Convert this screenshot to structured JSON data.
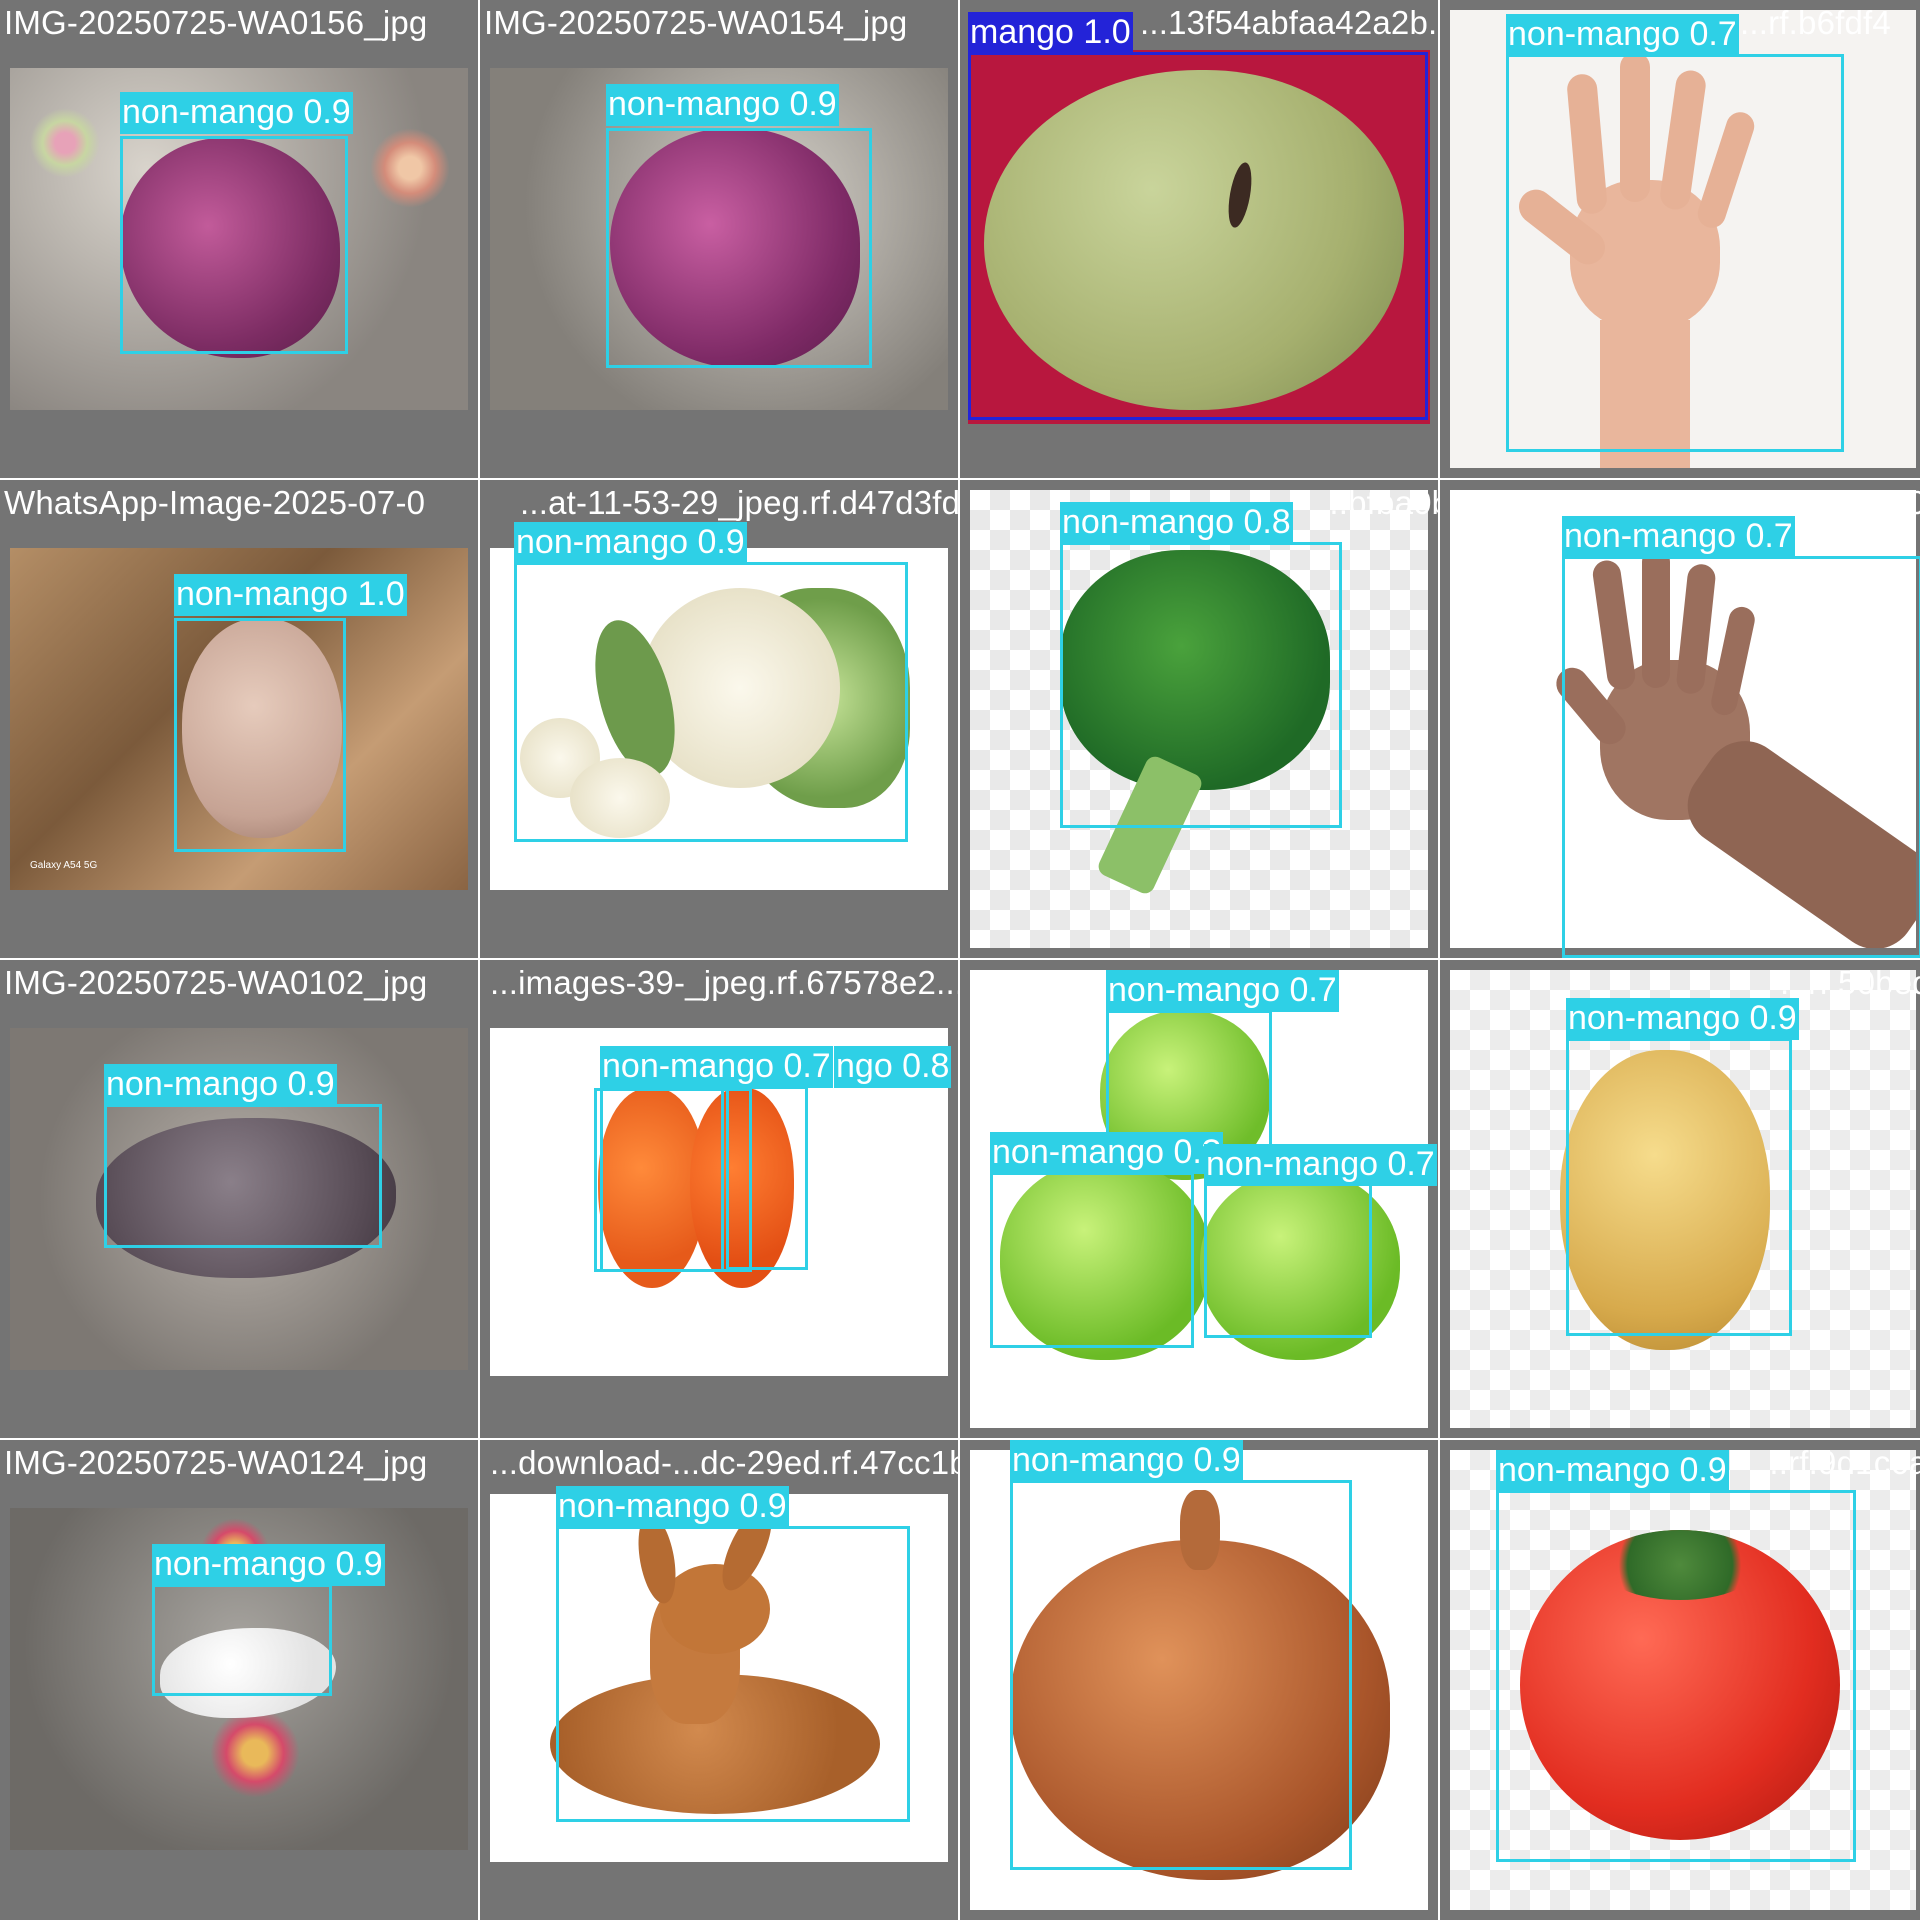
{
  "colors": {
    "box": "#2ed0e6",
    "box_mango": "#2323d8",
    "tile_bg": "#747474",
    "label_text": "#ffffff"
  },
  "tiles": [
    {
      "filename": "IMG-20250725-WA0156_jpg",
      "detections": [
        {
          "label": "non-mango 0.9"
        }
      ]
    },
    {
      "filename": "IMG-20250725-WA0154_jpg",
      "detections": [
        {
          "label": "non-mango 0.9"
        }
      ]
    },
    {
      "filename": "...13f54abfaa42a2b...",
      "detections": [
        {
          "label": "mango 1.0"
        }
      ]
    },
    {
      "filename": "...rf.b6fdf4",
      "detections": [
        {
          "label": "non-mango 0.7"
        }
      ]
    },
    {
      "filename": "WhatsApp-Image-2025-07-0",
      "detections": [
        {
          "label": "non-mango 1.0"
        }
      ]
    },
    {
      "filename": "...at-11-53-29_jpeg.rf.d47d3fd",
      "detections": [
        {
          "label": "non-mango 0.9"
        }
      ]
    },
    {
      "filename": "...bfba0bfd...",
      "detections": [
        {
          "label": "non-mango 0.8"
        }
      ]
    },
    {
      "filename": "...jpeg.rf.a5008",
      "detections": [
        {
          "label": "non-mango 0.7"
        }
      ]
    },
    {
      "filename": "IMG-20250725-WA0102_jpg",
      "detections": [
        {
          "label": "non-mango 0.7"
        },
        {
          "label": "non-mango 0.8"
        }
      ]
    },
    {
      "filename": "...images-39-_jpeg.rf.67578e2...",
      "detections": [
        {
          "label": "non-mango 0.7"
        },
        {
          "label": "non-mango 0.8"
        },
        {
          "label": "non-mango 0.7"
        }
      ]
    },
    {
      "filename": "...93c7...",
      "detections": [
        {
          "label": "non-mango 0.9"
        }
      ]
    },
    {
      "filename": "...rf.50bed",
      "detections": [
        {
          "label": "non-mango 0.9"
        }
      ]
    },
    {
      "filename": "IMG-20250725-WA0124_jpg",
      "detections": [
        {
          "label": "non-mango 0.9"
        }
      ]
    },
    {
      "filename": "...download-...dc-29ed.rf.47cc1b",
      "detections": [
        {
          "label": "non-mango 0.9"
        }
      ]
    },
    {
      "filename": "...rf.68e7d5d...",
      "detections": [
        {
          "label": "non-mango 0.9"
        }
      ]
    },
    {
      "filename": "...rf.9d1c6a",
      "detections": [
        {
          "label": "non-mango 0.9"
        }
      ]
    }
  ],
  "row3": {
    "tile0_label": "non-mango 0.9",
    "tile1_labels": [
      "non-mango 0.7",
      "ngo 0.8"
    ],
    "tile2_labels": [
      "non-mango 0.7",
      "non-mango 0.?",
      "non-mango 0.7"
    ],
    "tile3_label": "non-mango 0.9"
  },
  "watermark": "Galaxy A54 5G"
}
